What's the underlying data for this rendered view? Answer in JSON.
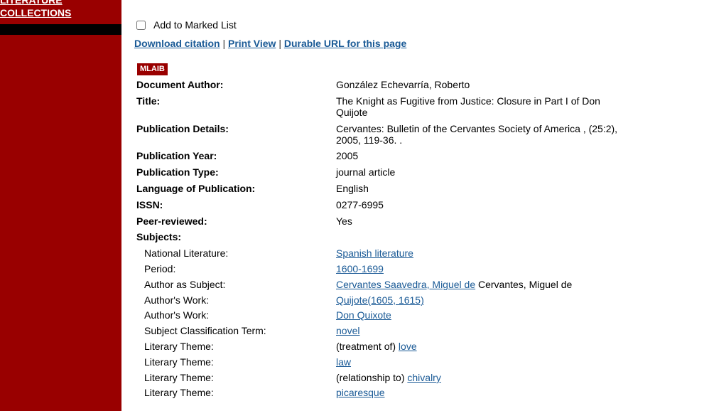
{
  "sidebar": {
    "nav_literature": "LITERATURE",
    "nav_collections": "COLLECTIONS"
  },
  "record_tools": {
    "marked_list_label": "Add to Marked List",
    "download_citation": "Download citation",
    "print_view": "Print View",
    "durable_url": "Durable URL for this page",
    "separator": "|"
  },
  "source_badge": "MLAIB",
  "record": {
    "author_label": "Document Author:",
    "author": "González Echevarría, Roberto",
    "title_label": "Title:",
    "title": "The Knight as Fugitive from Justice: Closure in Part I of Don Quijote",
    "pubdetails_label": "Publication Details:",
    "pubdetails": "Cervantes: Bulletin of the Cervantes Society of America , (25:2), 2005, 119-36. .",
    "pubyear_label": "Publication Year:",
    "pubyear": "2005",
    "pubtype_label": "Publication Type:",
    "pubtype": "journal article",
    "language_label": "Language of Publication:",
    "language": "English",
    "issn_label": "ISSN:",
    "issn": "0277-6995",
    "peer_label": "Peer-reviewed:",
    "peer": "Yes",
    "subjects_label": "Subjects:"
  },
  "subjects": [
    {
      "label": "National Literature:",
      "prefix": "",
      "link": "Spanish literature",
      "suffix": ""
    },
    {
      "label": "Period:",
      "prefix": "",
      "link": "1600-1699",
      "suffix": ""
    },
    {
      "label": "Author as Subject:",
      "prefix": "",
      "link": "Cervantes Saavedra, Miguel de",
      "suffix": " Cervantes, Miguel de"
    },
    {
      "label": "Author's Work:",
      "prefix": "",
      "link": "Quijote(1605, 1615)",
      "suffix": ""
    },
    {
      "label": "Author's Work:",
      "prefix": "",
      "link": "Don Quixote",
      "suffix": ""
    },
    {
      "label": "Subject Classification Term:",
      "prefix": "",
      "link": "novel",
      "suffix": ""
    },
    {
      "label": "Literary Theme:",
      "prefix": "(treatment of) ",
      "link": "love",
      "suffix": ""
    },
    {
      "label": "Literary Theme:",
      "prefix": "",
      "link": "law",
      "suffix": ""
    },
    {
      "label": "Literary Theme:",
      "prefix": "(relationship to) ",
      "link": "chivalry",
      "suffix": ""
    },
    {
      "label": "Literary Theme:",
      "prefix": "",
      "link": "picaresque",
      "suffix": ""
    }
  ],
  "colors": {
    "sidebar": "#990000",
    "link": "#1a5a96",
    "badge": "#990000"
  }
}
